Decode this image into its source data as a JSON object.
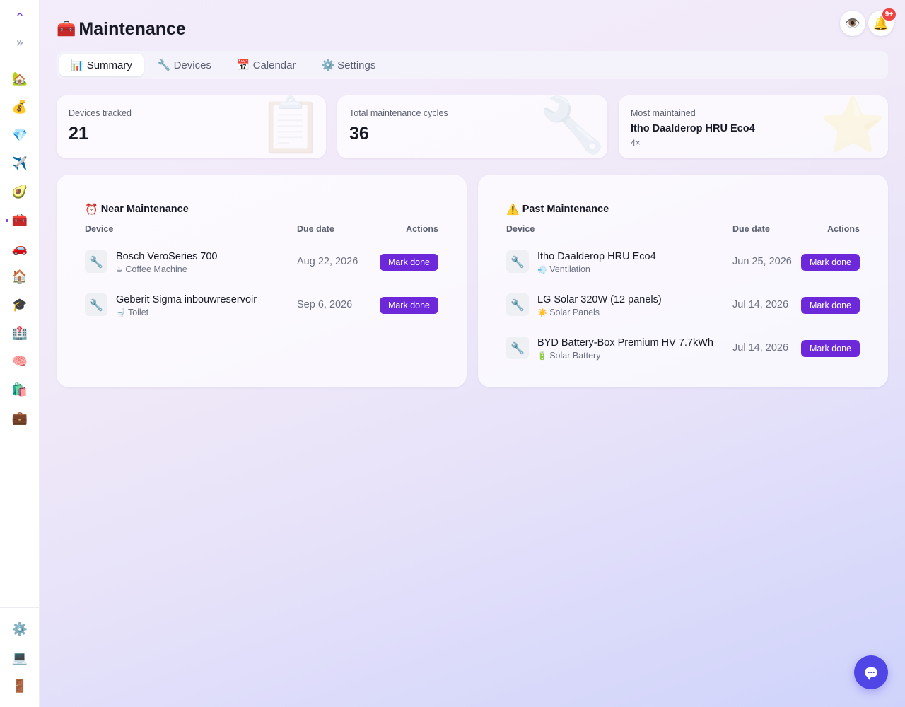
{
  "sidebar": {
    "logo_icon": "chevron-up-logo",
    "logo_glyph": "⌃",
    "expand_glyph": "»",
    "items": [
      {
        "name": "home",
        "glyph": "🏡"
      },
      {
        "name": "money",
        "glyph": "💰"
      },
      {
        "name": "gem",
        "glyph": "💎"
      },
      {
        "name": "travel",
        "glyph": "✈️"
      },
      {
        "name": "food",
        "glyph": "🥑"
      },
      {
        "name": "maintenance",
        "glyph": "🧰",
        "active": true
      },
      {
        "name": "car",
        "glyph": "🚗"
      },
      {
        "name": "house",
        "glyph": "🏠"
      },
      {
        "name": "education",
        "glyph": "🎓"
      },
      {
        "name": "health",
        "glyph": "🏥"
      },
      {
        "name": "mind",
        "glyph": "🧠"
      },
      {
        "name": "shopping",
        "glyph": "🛍️"
      },
      {
        "name": "work",
        "glyph": "💼"
      }
    ],
    "bottom": [
      {
        "name": "settings",
        "glyph": "⚙️"
      },
      {
        "name": "computer",
        "glyph": "💻"
      },
      {
        "name": "logout",
        "glyph": "🚪"
      }
    ]
  },
  "header": {
    "title_icon": "🧰",
    "title": "Maintenance",
    "eye_glyph": "👁️",
    "bell_glyph": "🔔",
    "notification_count": "9+"
  },
  "tabs": [
    {
      "icon": "📊",
      "label": "Summary",
      "active": true
    },
    {
      "icon": "🔧",
      "label": "Devices"
    },
    {
      "icon": "📅",
      "label": "Calendar"
    },
    {
      "icon": "⚙️",
      "label": "Settings"
    }
  ],
  "stats": {
    "devices": {
      "label": "Devices tracked",
      "value": "21",
      "deco": "📋"
    },
    "cycles": {
      "label": "Total maintenance cycles",
      "value": "36",
      "deco": "🔧"
    },
    "most": {
      "label": "Most maintained",
      "value": "Itho Daalderop HRU Eco4",
      "sub": "4×",
      "deco": "⭐"
    }
  },
  "near": {
    "title_icon": "⏰",
    "title": "Near Maintenance",
    "col_device": "Device",
    "col_due": "Due date",
    "col_actions": "Actions",
    "rows": [
      {
        "icon": "🔧",
        "name": "Bosch VeroSeries 700",
        "cat_icon": "☕",
        "category": "Coffee Machine",
        "due": "Aug 22, 2026",
        "action": "Mark done"
      },
      {
        "icon": "🔧",
        "name": "Geberit Sigma inbouwreservoir",
        "cat_icon": "🚽",
        "category": "Toilet",
        "due": "Sep 6, 2026",
        "action": "Mark done"
      }
    ]
  },
  "past": {
    "title_icon": "⚠️",
    "title": "Past Maintenance",
    "col_device": "Device",
    "col_due": "Due date",
    "col_actions": "Actions",
    "rows": [
      {
        "icon": "🔧",
        "name": "Itho Daalderop HRU Eco4",
        "cat_icon": "💨",
        "category": "Ventilation",
        "due": "Jun 25, 2026",
        "action": "Mark done"
      },
      {
        "icon": "🔧",
        "name": "LG Solar 320W (12 panels)",
        "cat_icon": "☀️",
        "category": "Solar Panels",
        "due": "Jul 14, 2026",
        "action": "Mark done"
      },
      {
        "icon": "🔧",
        "name": "BYD Battery-Box Premium HV 7.7kWh",
        "cat_icon": "🔋",
        "category": "Solar Battery",
        "due": "Jul 14, 2026",
        "action": "Mark done"
      }
    ]
  },
  "colors": {
    "accent": "#6d28d9",
    "chat": "#4f46e5",
    "badge": "#ef4444"
  }
}
